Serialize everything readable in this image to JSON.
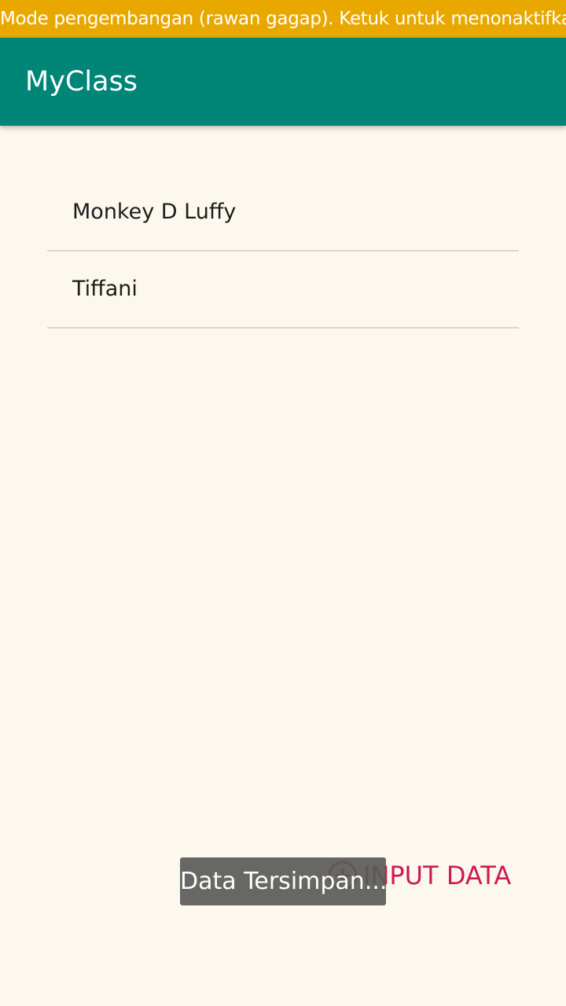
{
  "dev_banner": {
    "text": "Mode pengembangan (rawan gagap). Ketuk untuk menonaktifkan."
  },
  "app_bar": {
    "title": "MyClass"
  },
  "list": {
    "items": [
      {
        "label": "Monkey D Luffy"
      },
      {
        "label": "Tiffani"
      }
    ]
  },
  "input_button": {
    "label": "INPUT DATA",
    "icon": "add-circle-icon"
  },
  "toast": {
    "text": "Data Tersimpan..."
  },
  "colors": {
    "banner": "#e9a800",
    "app_bar": "#008577",
    "background": "#fdf8ee",
    "accent": "#cc1a55"
  }
}
